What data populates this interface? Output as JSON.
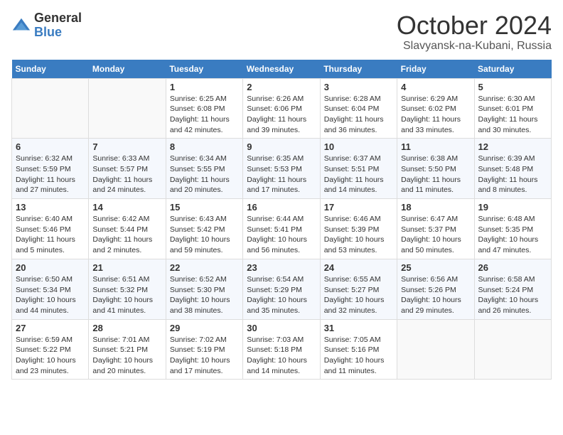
{
  "header": {
    "logo_line1": "General",
    "logo_line2": "Blue",
    "month": "October 2024",
    "location": "Slavyansk-na-Kubani, Russia"
  },
  "weekdays": [
    "Sunday",
    "Monday",
    "Tuesday",
    "Wednesday",
    "Thursday",
    "Friday",
    "Saturday"
  ],
  "weeks": [
    [
      {
        "day": "",
        "info": ""
      },
      {
        "day": "",
        "info": ""
      },
      {
        "day": "1",
        "info": "Sunrise: 6:25 AM\nSunset: 6:08 PM\nDaylight: 11 hours and 42 minutes."
      },
      {
        "day": "2",
        "info": "Sunrise: 6:26 AM\nSunset: 6:06 PM\nDaylight: 11 hours and 39 minutes."
      },
      {
        "day": "3",
        "info": "Sunrise: 6:28 AM\nSunset: 6:04 PM\nDaylight: 11 hours and 36 minutes."
      },
      {
        "day": "4",
        "info": "Sunrise: 6:29 AM\nSunset: 6:02 PM\nDaylight: 11 hours and 33 minutes."
      },
      {
        "day": "5",
        "info": "Sunrise: 6:30 AM\nSunset: 6:01 PM\nDaylight: 11 hours and 30 minutes."
      }
    ],
    [
      {
        "day": "6",
        "info": "Sunrise: 6:32 AM\nSunset: 5:59 PM\nDaylight: 11 hours and 27 minutes."
      },
      {
        "day": "7",
        "info": "Sunrise: 6:33 AM\nSunset: 5:57 PM\nDaylight: 11 hours and 24 minutes."
      },
      {
        "day": "8",
        "info": "Sunrise: 6:34 AM\nSunset: 5:55 PM\nDaylight: 11 hours and 20 minutes."
      },
      {
        "day": "9",
        "info": "Sunrise: 6:35 AM\nSunset: 5:53 PM\nDaylight: 11 hours and 17 minutes."
      },
      {
        "day": "10",
        "info": "Sunrise: 6:37 AM\nSunset: 5:51 PM\nDaylight: 11 hours and 14 minutes."
      },
      {
        "day": "11",
        "info": "Sunrise: 6:38 AM\nSunset: 5:50 PM\nDaylight: 11 hours and 11 minutes."
      },
      {
        "day": "12",
        "info": "Sunrise: 6:39 AM\nSunset: 5:48 PM\nDaylight: 11 hours and 8 minutes."
      }
    ],
    [
      {
        "day": "13",
        "info": "Sunrise: 6:40 AM\nSunset: 5:46 PM\nDaylight: 11 hours and 5 minutes."
      },
      {
        "day": "14",
        "info": "Sunrise: 6:42 AM\nSunset: 5:44 PM\nDaylight: 11 hours and 2 minutes."
      },
      {
        "day": "15",
        "info": "Sunrise: 6:43 AM\nSunset: 5:42 PM\nDaylight: 10 hours and 59 minutes."
      },
      {
        "day": "16",
        "info": "Sunrise: 6:44 AM\nSunset: 5:41 PM\nDaylight: 10 hours and 56 minutes."
      },
      {
        "day": "17",
        "info": "Sunrise: 6:46 AM\nSunset: 5:39 PM\nDaylight: 10 hours and 53 minutes."
      },
      {
        "day": "18",
        "info": "Sunrise: 6:47 AM\nSunset: 5:37 PM\nDaylight: 10 hours and 50 minutes."
      },
      {
        "day": "19",
        "info": "Sunrise: 6:48 AM\nSunset: 5:35 PM\nDaylight: 10 hours and 47 minutes."
      }
    ],
    [
      {
        "day": "20",
        "info": "Sunrise: 6:50 AM\nSunset: 5:34 PM\nDaylight: 10 hours and 44 minutes."
      },
      {
        "day": "21",
        "info": "Sunrise: 6:51 AM\nSunset: 5:32 PM\nDaylight: 10 hours and 41 minutes."
      },
      {
        "day": "22",
        "info": "Sunrise: 6:52 AM\nSunset: 5:30 PM\nDaylight: 10 hours and 38 minutes."
      },
      {
        "day": "23",
        "info": "Sunrise: 6:54 AM\nSunset: 5:29 PM\nDaylight: 10 hours and 35 minutes."
      },
      {
        "day": "24",
        "info": "Sunrise: 6:55 AM\nSunset: 5:27 PM\nDaylight: 10 hours and 32 minutes."
      },
      {
        "day": "25",
        "info": "Sunrise: 6:56 AM\nSunset: 5:26 PM\nDaylight: 10 hours and 29 minutes."
      },
      {
        "day": "26",
        "info": "Sunrise: 6:58 AM\nSunset: 5:24 PM\nDaylight: 10 hours and 26 minutes."
      }
    ],
    [
      {
        "day": "27",
        "info": "Sunrise: 6:59 AM\nSunset: 5:22 PM\nDaylight: 10 hours and 23 minutes."
      },
      {
        "day": "28",
        "info": "Sunrise: 7:01 AM\nSunset: 5:21 PM\nDaylight: 10 hours and 20 minutes."
      },
      {
        "day": "29",
        "info": "Sunrise: 7:02 AM\nSunset: 5:19 PM\nDaylight: 10 hours and 17 minutes."
      },
      {
        "day": "30",
        "info": "Sunrise: 7:03 AM\nSunset: 5:18 PM\nDaylight: 10 hours and 14 minutes."
      },
      {
        "day": "31",
        "info": "Sunrise: 7:05 AM\nSunset: 5:16 PM\nDaylight: 10 hours and 11 minutes."
      },
      {
        "day": "",
        "info": ""
      },
      {
        "day": "",
        "info": ""
      }
    ]
  ]
}
